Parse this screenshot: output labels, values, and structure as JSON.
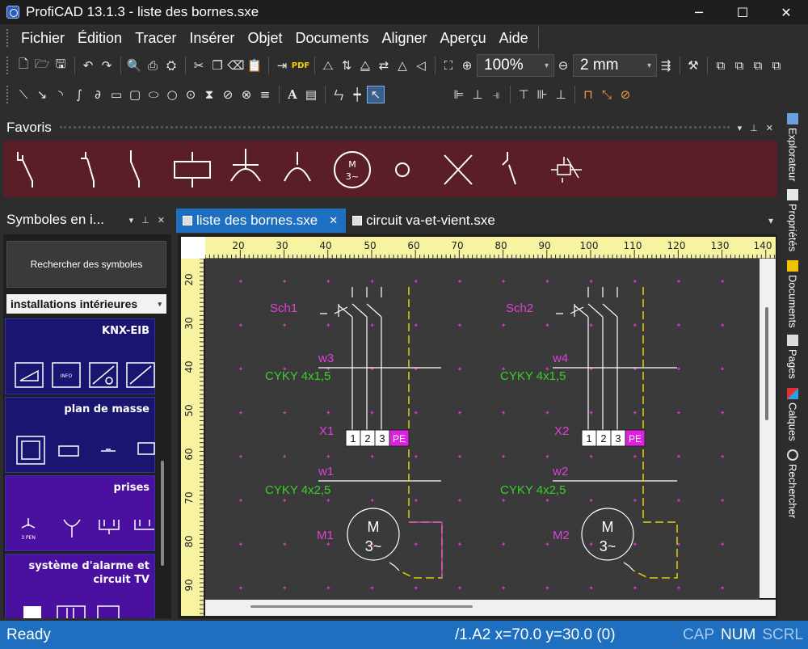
{
  "window": {
    "title": "ProfiCAD 13.1.3 - liste des bornes.sxe",
    "min": "─",
    "max": "☐",
    "close": "✕"
  },
  "menu": [
    "Fichier",
    "Édition",
    "Tracer",
    "Insérer",
    "Objet",
    "Documents",
    "Aligner",
    "Aperçu",
    "Aide"
  ],
  "toolbar": {
    "zoom": "100%",
    "grid": "2 mm",
    "pdf": "PDF"
  },
  "favoris": {
    "title": "Favoris",
    "pin": "📌",
    "close": "✕",
    "dropdown": "▾"
  },
  "symbols_panel": {
    "title": "Symboles en i...",
    "search_button": "Rechercher des symboles",
    "category_selected": "installations intérieures",
    "categories": [
      {
        "name": "KNX-EIB",
        "color": "blue"
      },
      {
        "name": "plan de masse",
        "color": "blue"
      },
      {
        "name": "prises",
        "color": "violet"
      },
      {
        "name": "système d'alarme et circuit TV",
        "color": "violet"
      }
    ],
    "prise_label": "3 PEN",
    "knx_label": "INFO"
  },
  "tabs": [
    {
      "label": "liste des bornes.sxe",
      "active": true
    },
    {
      "label": "circuit va-et-vient.sxe",
      "active": false
    }
  ],
  "rulers": {
    "top": [
      "20",
      "30",
      "40",
      "50",
      "60",
      "70",
      "80",
      "90",
      "100",
      "110",
      "120",
      "130",
      "140"
    ],
    "left": [
      "20",
      "30",
      "40",
      "50",
      "60",
      "70",
      "80",
      "90"
    ]
  },
  "drawing": {
    "circuits": [
      {
        "switch": "Sch1",
        "cable1": "w3",
        "cable1_type": "CYKY 4x1,5",
        "terminal": "X1",
        "cable2": "w1",
        "cable2_type": "CYKY 4x2,5",
        "motor": "M1"
      },
      {
        "switch": "Sch2",
        "cable1": "w4",
        "cable1_type": "CYKY 4x1,5",
        "terminal": "X2",
        "cable2": "w2",
        "cable2_type": "CYKY 4x2,5",
        "motor": "M2"
      }
    ],
    "terminals": [
      "1",
      "2",
      "3",
      "PE"
    ],
    "motor_letter": "M",
    "motor_phase": "3~"
  },
  "side_tabs": [
    "Explorateur",
    "Propriétés",
    "Documents",
    "Pages",
    "Calques",
    "Rechercher"
  ],
  "status": {
    "ready": "Ready",
    "coords": "/1.A2  x=70.0  y=30.0 (0)",
    "cap": "CAP",
    "num": "NUM",
    "scrl": "SCRL"
  },
  "colors": {
    "accent": "#1e6fc0",
    "favbar": "#5a1e28",
    "label_magenta": "#e040d8",
    "label_green": "#39d02a",
    "ruler": "#f7f3a0"
  }
}
